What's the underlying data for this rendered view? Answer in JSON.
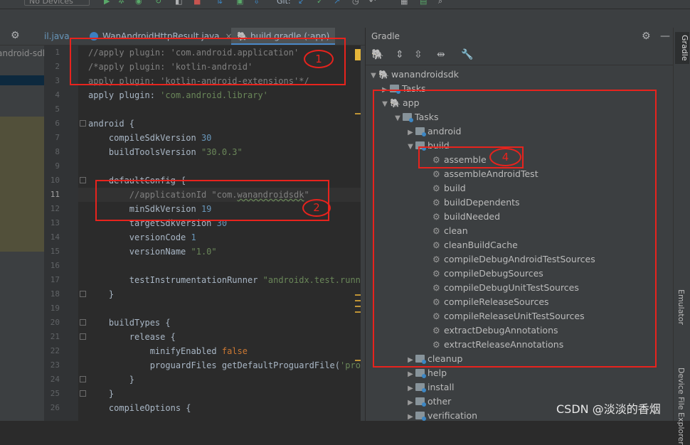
{
  "toolbar": {
    "devices": "No Devices",
    "git": "Git:"
  },
  "project": {
    "item": "android-sdk"
  },
  "tabs": [
    {
      "label": "il.java"
    },
    {
      "label": "WanAndroidHttpResult.java"
    },
    {
      "label": "build.gradle (:app)"
    }
  ],
  "tab_close": "×",
  "line_numbers": [
    "1",
    "2",
    "3",
    "4",
    "5",
    "6",
    "7",
    "8",
    "9",
    "10",
    "11",
    "12",
    "13",
    "14",
    "15",
    "16",
    "17",
    "18",
    "19",
    "20",
    "21",
    "22",
    "23",
    "24",
    "25",
    "26"
  ],
  "code": {
    "l1": "//apply plugin: 'com.android.application'",
    "l2": "/*apply plugin: 'kotlin-android'",
    "l3": "apply plugin: 'kotlin-android-extensions'*/",
    "l4a": "apply plugin: ",
    "l4b": "'com.android.library'",
    "l6": "android {",
    "l7a": "    compileSdkVersion ",
    "l7b": "30",
    "l8a": "    buildToolsVersion ",
    "l8b": "\"30.0.3\"",
    "l10": "    defaultConfig {",
    "l11a": "        //applicationId \"com.",
    "l11b": "wanandroidsdk",
    "l11c": "\"",
    "l12a": "        minSdkVersion ",
    "l12b": "19",
    "l13a": "        targetSdkVersion ",
    "l13b": "30",
    "l14a": "        versionCode ",
    "l14b": "1",
    "l15a": "        versionName ",
    "l15b": "\"1.0\"",
    "l17a": "        testInstrumentationRunner ",
    "l17b": "\"androidx.test.runner.",
    "l18": "    }",
    "l20": "    buildTypes {",
    "l21": "        release {",
    "l22a": "            minifyEnabled ",
    "l22b": "false",
    "l23a": "            proguardFiles getDefaultProguardFile(",
    "l23b": "'progua",
    "l24": "        }",
    "l25": "    }",
    "l26": "    compileOptions {"
  },
  "gradle": {
    "title": "Gradle",
    "tree": [
      {
        "label": "wanandroidsdk"
      },
      {
        "label": "Tasks"
      },
      {
        "label": "app"
      },
      {
        "label": "Tasks"
      },
      {
        "label": "android"
      },
      {
        "label": "build"
      },
      {
        "label": "assemble"
      },
      {
        "label": "assembleAndroidTest"
      },
      {
        "label": "build"
      },
      {
        "label": "buildDependents"
      },
      {
        "label": "buildNeeded"
      },
      {
        "label": "clean"
      },
      {
        "label": "cleanBuildCache"
      },
      {
        "label": "compileDebugAndroidTestSources"
      },
      {
        "label": "compileDebugSources"
      },
      {
        "label": "compileDebugUnitTestSources"
      },
      {
        "label": "compileReleaseSources"
      },
      {
        "label": "compileReleaseUnitTestSources"
      },
      {
        "label": "extractDebugAnnotations"
      },
      {
        "label": "extractReleaseAnnotations"
      },
      {
        "label": "cleanup"
      },
      {
        "label": "help"
      },
      {
        "label": "install"
      },
      {
        "label": "other"
      },
      {
        "label": "verification"
      }
    ]
  },
  "right_strip": {
    "tab1": "Gradle",
    "tab2": "Emulator",
    "tab3": "Device File Explorer"
  },
  "annotations": {
    "n1": "1",
    "n2": "2",
    "n4": "4"
  },
  "watermark": "CSDN @淡淡的香烟",
  "colors": {
    "accent_red": "#e8231d",
    "comment": "#808080",
    "string": "#6a8759",
    "number": "#6897bb",
    "keyword": "#cc7832"
  }
}
